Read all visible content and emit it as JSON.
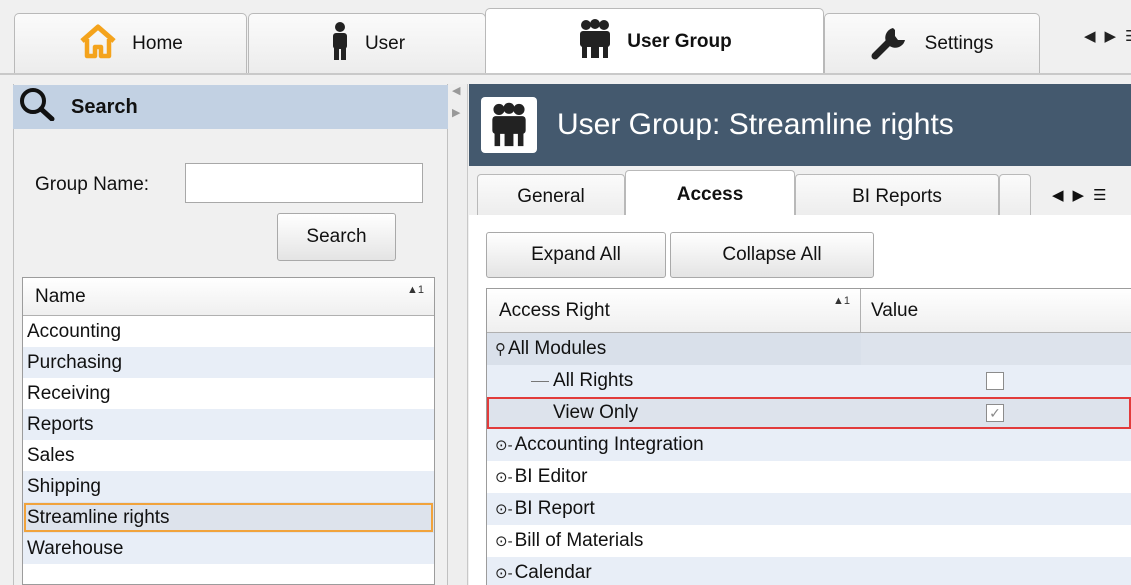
{
  "top_tabs": [
    {
      "label": "Home",
      "icon": "home-icon",
      "active": false
    },
    {
      "label": "User",
      "icon": "user-icon",
      "active": false
    },
    {
      "label": "User Group",
      "icon": "user-group-icon",
      "active": true
    },
    {
      "label": "Settings",
      "icon": "wrench-icon",
      "active": false
    }
  ],
  "search": {
    "header": "Search",
    "group_name_label": "Group Name:",
    "group_name_value": "",
    "search_button": "Search",
    "list_header": "Name",
    "sort_indicator": "1",
    "items": [
      "Accounting",
      "Purchasing",
      "Receiving",
      "Reports",
      "Sales",
      "Shipping",
      "Streamline rights",
      "Warehouse"
    ],
    "selected": "Streamline rights"
  },
  "detail": {
    "title": "User Group: Streamline rights",
    "tabs": [
      "General",
      "Access",
      "BI Reports"
    ],
    "active_tab": "Access",
    "expand_all": "Expand All",
    "collapse_all": "Collapse All",
    "grid": {
      "col_access_right": "Access Right",
      "col_value": "Value",
      "sort_indicator": "1",
      "rows": [
        {
          "label": "All Modules",
          "type": "group-expanded"
        },
        {
          "label": "All Rights",
          "type": "child",
          "checked": false
        },
        {
          "label": "View Only",
          "type": "child",
          "checked": true,
          "selected": true
        },
        {
          "label": "Accounting Integration",
          "type": "group"
        },
        {
          "label": "BI Editor",
          "type": "group"
        },
        {
          "label": "BI Report",
          "type": "group"
        },
        {
          "label": "Bill of Materials",
          "type": "group"
        },
        {
          "label": "Calendar",
          "type": "group"
        }
      ]
    }
  },
  "colors": {
    "header_bg": "#44596e",
    "search_header_bg": "#c2d1e3",
    "selection_outline_list": "#f1a33c",
    "selection_outline_grid": "#e23b3b"
  }
}
